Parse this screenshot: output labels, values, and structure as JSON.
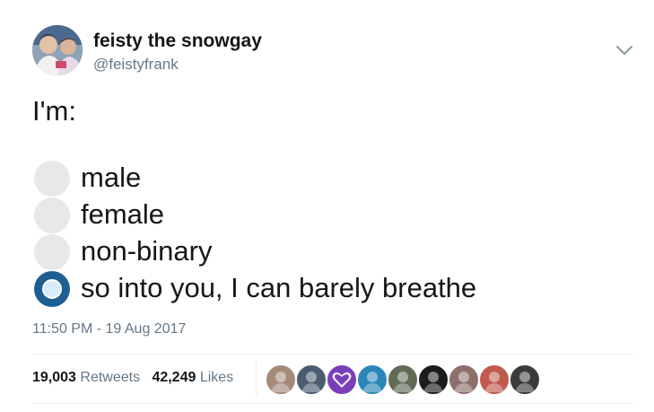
{
  "tweet": {
    "author": {
      "display_name": "feisty the snowgay",
      "handle": "@feistyfrank",
      "avatar_icon": "profile-photo"
    },
    "text": "I'm:",
    "poll": {
      "options": [
        {
          "label": "male",
          "selected": false
        },
        {
          "label": "female",
          "selected": false
        },
        {
          "label": "non-binary",
          "selected": false
        },
        {
          "label": "so into you, I can barely breathe",
          "selected": true
        }
      ]
    },
    "timestamp": "11:50 PM - 19 Aug 2017",
    "stats": {
      "retweets_count": "19,003",
      "retweets_label": "Retweets",
      "likes_count": "42,249",
      "likes_label": "Likes"
    },
    "liker_avatars": [
      {
        "icon": "user-avatar",
        "color": "#a58a7a"
      },
      {
        "icon": "user-avatar",
        "color": "#4a5c70"
      },
      {
        "icon": "purple-heart-avatar",
        "color": "#7a3fb8"
      },
      {
        "icon": "user-avatar",
        "color": "#2b86b8"
      },
      {
        "icon": "user-avatar",
        "color": "#5f6b55"
      },
      {
        "icon": "user-avatar",
        "color": "#1c1c1c"
      },
      {
        "icon": "user-avatar",
        "color": "#8e6f6a"
      },
      {
        "icon": "user-avatar",
        "color": "#c05a4e"
      },
      {
        "icon": "user-avatar",
        "color": "#3b3b3b"
      }
    ],
    "colors": {
      "text": "#14171a",
      "secondary_text": "#657786",
      "poll_selected": "#1d5f93",
      "poll_unselected": "#e6e8ea",
      "divider": "#e6ecf0"
    }
  }
}
